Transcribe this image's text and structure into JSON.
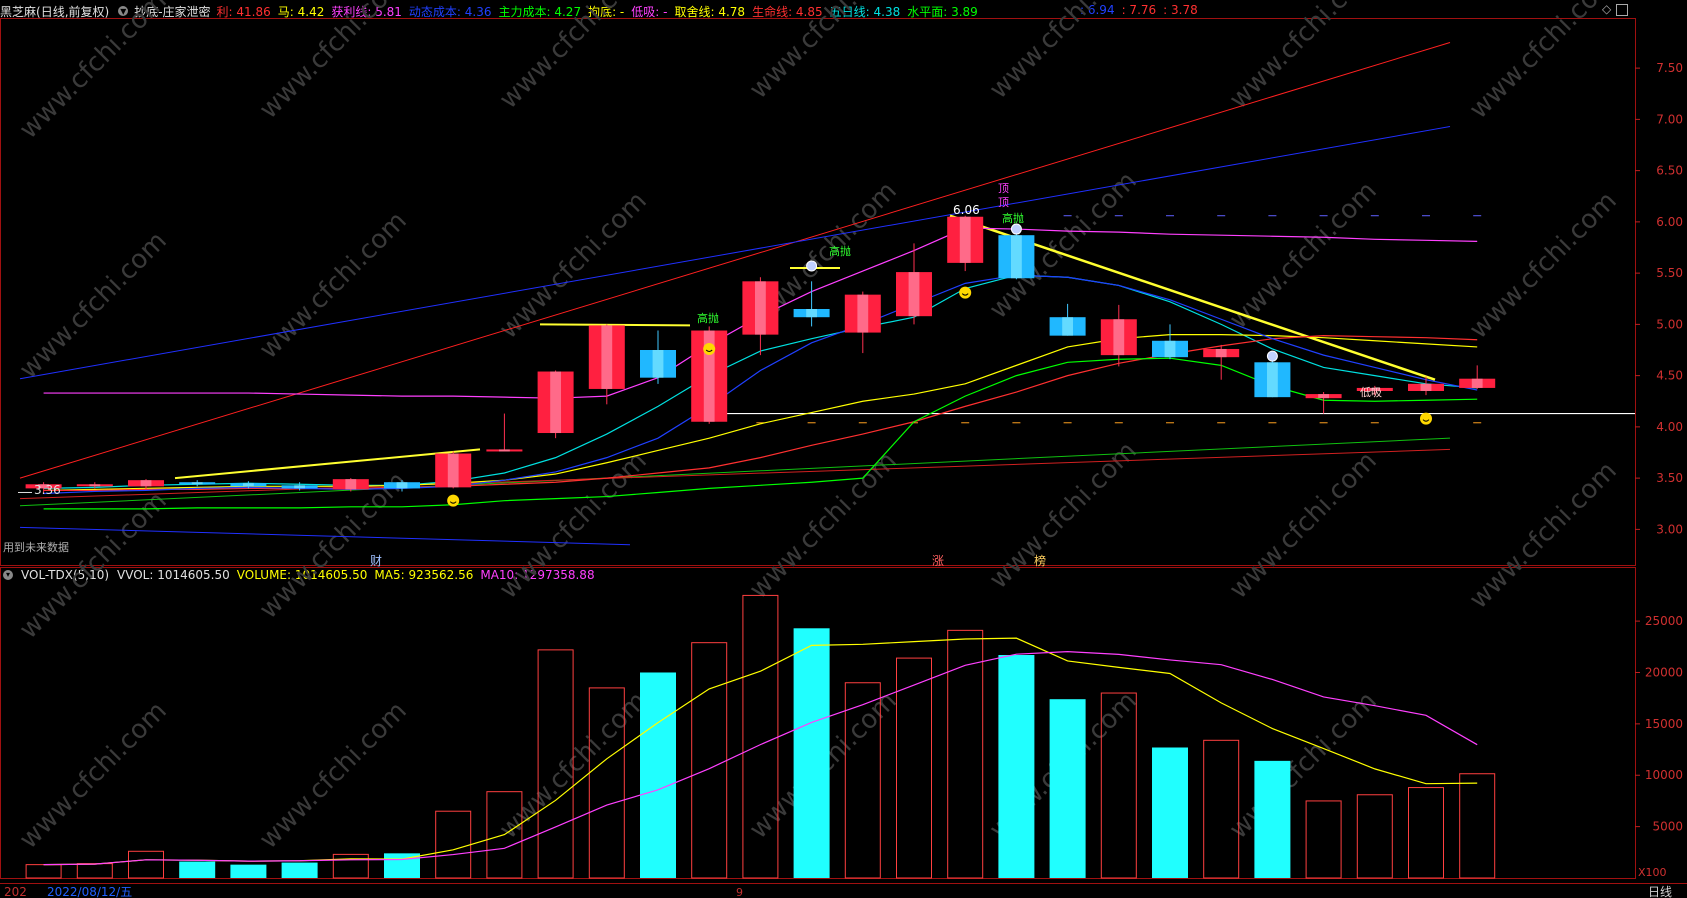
{
  "header": {
    "stock_name": "黑芝麻",
    "period": "(日线,前复权)",
    "indicator": "抄底-庄家泄密",
    "items": [
      {
        "label": "利: 41.86",
        "color": "#ff3030"
      },
      {
        "label": "马: 4.42",
        "color": "#ffff00"
      },
      {
        "label": "获利线: 5.81",
        "color": "#ff40ff"
      },
      {
        "label": "动态成本: 4.36",
        "color": "#2040ff"
      },
      {
        "label": "主力成本: 4.27",
        "color": "#00ff00"
      },
      {
        "label": "拘底: -",
        "color": "#ffff00"
      },
      {
        "label": "低吸: -",
        "color": "#ff40ff"
      },
      {
        "label": "取舍线: 4.78",
        "color": "#ffff00"
      },
      {
        "label": "生命线: 4.85",
        "color": "#ff3030"
      },
      {
        "label": "五日线: 4.38",
        "color": "#00e0e0"
      },
      {
        "label": "水平面: 3.89",
        "color": "#00ff00"
      }
    ],
    "right_items": [
      {
        "label": ": 6.94",
        "color": "#2040ff"
      },
      {
        "label": ": 7.76",
        "color": "#ff3030"
      },
      {
        "label": ": 3.78",
        "color": "#ff3030"
      }
    ]
  },
  "vol_header": {
    "name": "VOL-TDX(5,10)",
    "items": [
      {
        "label": "VVOL: 1014605.50",
        "color": "#e0e0e0"
      },
      {
        "label": "VOLUME: 1014605.50",
        "color": "#ffff00"
      },
      {
        "label": "MA5: 923562.56",
        "color": "#ffff00"
      },
      {
        "label": "MA10: 1297358.88",
        "color": "#ff40ff"
      }
    ]
  },
  "annotations": {
    "future_data": "用到未来数据",
    "low_price": "3.36",
    "high_price": "6.06",
    "gaopao": "高抛",
    "dixi": "低吸",
    "ding": "顶",
    "markers": [
      "财",
      "涨",
      "榜"
    ],
    "date_label": "2022/08/12/五",
    "date_prefix": "202",
    "month_tick": "9",
    "x100": "X100",
    "period_tab": "日线",
    "watermark": "www.cfchi.com"
  },
  "chart_data": [
    {
      "type": "candlestick",
      "title": "黑芝麻 (日线,前复权)",
      "yaxis_ticks": [
        "7.50",
        "7.00",
        "6.50",
        "6.00",
        "5.50",
        "5.00",
        "4.50",
        "4.00",
        "3.50",
        "3.00"
      ],
      "ylim": [
        2.75,
        7.95
      ],
      "candles": [
        {
          "o": 3.4,
          "c": 3.44,
          "h": 3.46,
          "l": 3.36
        },
        {
          "o": 3.43,
          "c": 3.44,
          "h": 3.46,
          "l": 3.4
        },
        {
          "o": 3.42,
          "c": 3.48,
          "h": 3.49,
          "l": 3.39
        },
        {
          "o": 3.46,
          "c": 3.44,
          "h": 3.48,
          "l": 3.42
        },
        {
          "o": 3.45,
          "c": 3.42,
          "h": 3.47,
          "l": 3.4
        },
        {
          "o": 3.43,
          "c": 3.4,
          "h": 3.46,
          "l": 3.38
        },
        {
          "o": 3.39,
          "c": 3.49,
          "h": 3.5,
          "l": 3.37
        },
        {
          "o": 3.46,
          "c": 3.4,
          "h": 3.48,
          "l": 3.37
        },
        {
          "o": 3.41,
          "c": 3.74,
          "h": 3.76,
          "l": 3.4
        },
        {
          "o": 3.76,
          "c": 3.78,
          "h": 4.13,
          "l": 3.77
        },
        {
          "o": 3.94,
          "c": 4.54,
          "h": 4.55,
          "l": 3.89
        },
        {
          "o": 4.37,
          "c": 4.99,
          "h": 5.0,
          "l": 4.22
        },
        {
          "o": 4.75,
          "c": 4.48,
          "h": 4.94,
          "l": 4.42
        },
        {
          "o": 4.05,
          "c": 4.94,
          "h": 4.98,
          "l": 4.03
        },
        {
          "o": 4.9,
          "c": 5.42,
          "h": 5.46,
          "l": 4.7
        },
        {
          "o": 5.15,
          "c": 5.07,
          "h": 5.42,
          "l": 4.98
        },
        {
          "o": 4.92,
          "c": 5.29,
          "h": 5.32,
          "l": 4.72
        },
        {
          "o": 5.08,
          "c": 5.51,
          "h": 5.79,
          "l": 5.0
        },
        {
          "o": 5.6,
          "c": 6.05,
          "h": 6.06,
          "l": 5.52
        },
        {
          "o": 5.87,
          "c": 5.45,
          "h": 5.91,
          "l": 5.44
        },
        {
          "o": 5.07,
          "c": 4.89,
          "h": 5.2,
          "l": 4.89
        },
        {
          "o": 4.7,
          "c": 5.05,
          "h": 5.19,
          "l": 4.59
        },
        {
          "o": 4.84,
          "c": 4.68,
          "h": 5.0,
          "l": 4.66
        },
        {
          "o": 4.68,
          "c": 4.76,
          "h": 4.8,
          "l": 4.46
        },
        {
          "o": 4.63,
          "c": 4.29,
          "h": 4.7,
          "l": 4.29
        },
        {
          "o": 4.28,
          "c": 4.32,
          "h": 4.34,
          "l": 4.13
        },
        {
          "o": 4.35,
          "c": 4.38,
          "h": 4.4,
          "l": 4.31
        },
        {
          "o": 4.35,
          "c": 4.42,
          "h": 4.49,
          "l": 4.31
        },
        {
          "o": 4.38,
          "c": 4.47,
          "h": 4.6,
          "l": 4.37
        }
      ],
      "series": [
        {
          "name": "五日线",
          "color": "#00e0e0",
          "values": [
            3.4,
            3.41,
            3.43,
            3.44,
            3.45,
            3.44,
            3.43,
            3.43,
            3.47,
            3.55,
            3.7,
            3.93,
            4.2,
            4.5,
            4.74,
            4.86,
            4.97,
            5.07,
            5.35,
            5.48,
            5.46,
            5.38,
            5.22,
            5.0,
            4.76,
            4.58,
            4.5,
            4.42,
            4.38
          ]
        },
        {
          "name": "取舍线",
          "color": "#ffff00",
          "values": [
            3.38,
            3.39,
            3.4,
            3.41,
            3.42,
            3.42,
            3.42,
            3.43,
            3.45,
            3.48,
            3.54,
            3.65,
            3.77,
            3.89,
            4.03,
            4.14,
            4.25,
            4.32,
            4.42,
            4.6,
            4.78,
            4.86,
            4.9,
            4.9,
            4.89,
            4.87,
            4.84,
            4.81,
            4.78
          ]
        },
        {
          "name": "生命线",
          "color": "#ff3030",
          "values": [
            3.38,
            3.38,
            3.39,
            3.39,
            3.4,
            3.4,
            3.4,
            3.41,
            3.42,
            3.44,
            3.46,
            3.5,
            3.55,
            3.6,
            3.7,
            3.82,
            3.93,
            4.05,
            4.2,
            4.34,
            4.5,
            4.62,
            4.71,
            4.79,
            4.86,
            4.89,
            4.88,
            4.87,
            4.85
          ]
        },
        {
          "name": "获利线",
          "color": "#ff40ff",
          "values": [
            4.33,
            4.33,
            4.33,
            4.33,
            4.33,
            4.32,
            4.31,
            4.3,
            4.3,
            4.29,
            4.28,
            4.3,
            4.48,
            4.8,
            5.08,
            5.32,
            5.52,
            5.72,
            5.94,
            5.93,
            5.91,
            5.9,
            5.88,
            5.87,
            5.86,
            5.85,
            5.83,
            5.82,
            5.81
          ]
        },
        {
          "name": "动态成本",
          "color": "#2040ff",
          "values": [
            3.35,
            3.37,
            3.38,
            3.4,
            3.41,
            3.4,
            3.39,
            3.4,
            3.42,
            3.48,
            3.56,
            3.7,
            3.89,
            4.2,
            4.55,
            4.82,
            5.0,
            5.2,
            5.4,
            5.48,
            5.46,
            5.38,
            5.24,
            5.05,
            4.86,
            4.7,
            4.58,
            4.46,
            4.36
          ]
        },
        {
          "name": "主力成本",
          "color": "#00ff00",
          "values": [
            3.2,
            3.2,
            3.2,
            3.21,
            3.21,
            3.21,
            3.22,
            3.22,
            3.24,
            3.28,
            3.3,
            3.32,
            3.36,
            3.4,
            3.43,
            3.46,
            3.5,
            4.05,
            4.3,
            4.5,
            4.63,
            4.66,
            4.67,
            4.6,
            4.4,
            4.26,
            4.25,
            4.26,
            4.27
          ]
        }
      ]
    },
    {
      "type": "bar",
      "title": "VOL-TDX(5,10)",
      "yaxis_ticks": [
        "25000",
        "20000",
        "15000",
        "10000",
        "5000"
      ],
      "ylim": [
        0,
        29000
      ],
      "unit": "X100",
      "values": [
        1300,
        1400,
        2600,
        1600,
        1300,
        1500,
        2300,
        2400,
        6500,
        8400,
        22200,
        18500,
        20000,
        22900,
        27500,
        24300,
        19000,
        21400,
        24100,
        21700,
        17400,
        18000,
        12700,
        13400,
        11400,
        7500,
        8100,
        8800,
        10146
      ],
      "down_days": [
        false,
        false,
        false,
        true,
        true,
        true,
        false,
        true,
        false,
        false,
        false,
        false,
        true,
        false,
        false,
        true,
        false,
        false,
        false,
        true,
        true,
        false,
        true,
        false,
        true,
        false,
        false,
        false,
        false
      ],
      "series": [
        {
          "name": "MA5",
          "color": "#ffff00",
          "values": [
            1300,
            1350,
            1770,
            1730,
            1640,
            1680,
            1860,
            1840,
            2740,
            4220,
            7560,
            11600,
            15120,
            18400,
            20120,
            22640,
            22740,
            23000,
            23260,
            23340,
            21120,
            20500,
            19900,
            17040,
            14540,
            12600,
            10620,
            9180,
            9236
          ]
        },
        {
          "name": "MA10",
          "color": "#ff40ff",
          "values": [
            1300,
            1350,
            1770,
            1730,
            1640,
            1680,
            1770,
            1800,
            2280,
            2890,
            4970,
            7100,
            8580,
            10640,
            12980,
            15140,
            16870,
            18770,
            20700,
            21780,
            22030,
            21760,
            21220,
            20760,
            19320,
            17620,
            16770,
            15830,
            12974
          ]
        }
      ]
    }
  ]
}
